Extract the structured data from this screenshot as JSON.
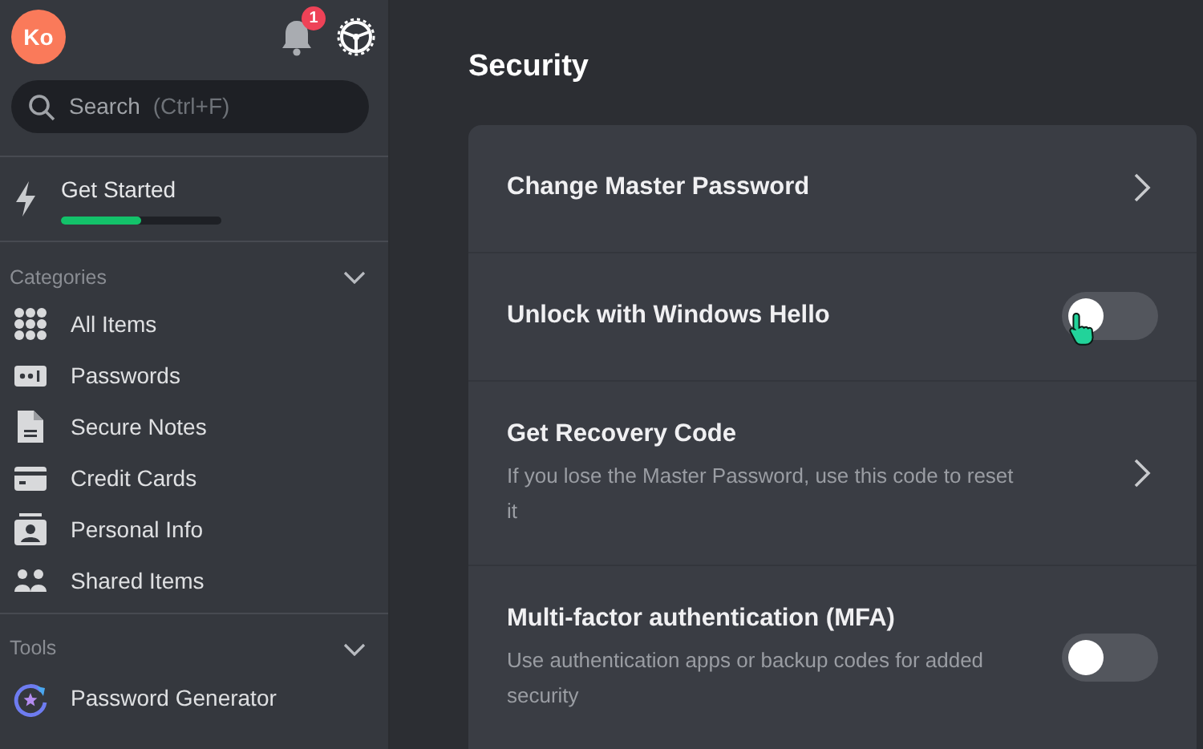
{
  "sidebar": {
    "avatar": "Ko",
    "notifications": {
      "count": "1"
    },
    "search": {
      "placeholder": "Search",
      "hint": "(Ctrl+F)"
    },
    "get_started": {
      "label": "Get Started",
      "level": 0.5
    },
    "categories": {
      "title": "Categories",
      "expanded": true,
      "items": [
        {
          "label": "All Items"
        },
        {
          "label": "Passwords"
        },
        {
          "label": "Secure Notes"
        },
        {
          "label": "Credit Cards"
        },
        {
          "label": "Personal Info"
        },
        {
          "label": "Shared Items"
        }
      ]
    },
    "tools": {
      "title": "Tools",
      "expanded": true,
      "items": [
        {
          "label": "Password Generator"
        }
      ]
    }
  },
  "main": {
    "title": "Security",
    "rows": [
      {
        "kind": "link",
        "title": "Change Master Password"
      },
      {
        "kind": "toggle",
        "title": "Unlock with Windows Hello",
        "on": false,
        "hovered": true
      },
      {
        "kind": "link",
        "title": "Get Recovery Code",
        "description": "If you lose the Master Password, use this code to reset it"
      },
      {
        "kind": "toggle",
        "title": "Multi-factor authentication (MFA)",
        "description": "Use authentication apps or backup codes for added security",
        "on": false,
        "hovered": false
      }
    ]
  }
}
